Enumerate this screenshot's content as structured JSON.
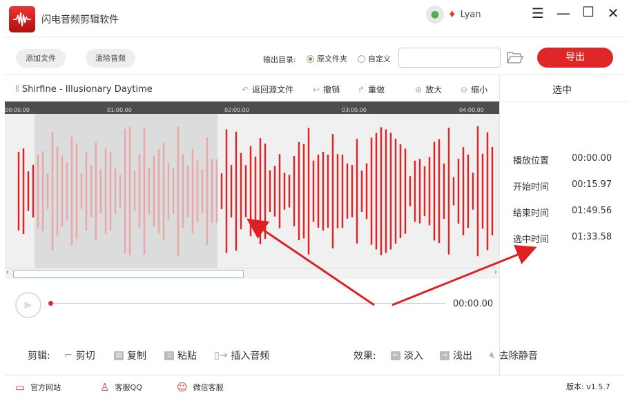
{
  "app": {
    "title": "闪电音频剪辑软件",
    "username": "Lyan"
  },
  "toolbar": {
    "add_file": "添加文件",
    "clear_audio": "清除音频",
    "output_label": "输出目录:",
    "opt_source": "原文件夹",
    "opt_custom": "自定义",
    "selected_option": "原文件夹",
    "path_value": "",
    "export": "导出"
  },
  "track": {
    "name": "Shirfine - Illusionary Daytime",
    "revert": "返回源文件",
    "undo": "撤销",
    "redo": "重做",
    "zoom_in": "放大",
    "zoom_out": "缩小",
    "timeline_ticks": [
      "00:00.00",
      "01:00.00",
      "02:00.00",
      "03:00.00",
      "04:00.00"
    ]
  },
  "side": {
    "title": "选中",
    "rows": [
      {
        "label": "播放位置",
        "value": "00:00.00"
      },
      {
        "label": "开始时间",
        "value": "00:15.97"
      },
      {
        "label": "结束时间",
        "value": "01:49.56"
      },
      {
        "label": "选中时间",
        "value": "01:33.58"
      }
    ]
  },
  "player": {
    "time": "00:00.00",
    "progress": 0
  },
  "edit": {
    "label": "剪辑:",
    "cut": "剪切",
    "copy": "复制",
    "paste": "粘贴",
    "insert": "插入音频",
    "effects_label": "效果:",
    "fade_in": "淡入",
    "fade_out": "浅出",
    "remove_silence": "去除静音"
  },
  "footer": {
    "website": "官方网站",
    "qq": "客服QQ",
    "wechat": "微信客服",
    "version": "版本: v1.5.7"
  },
  "colors": {
    "accent": "#e02727",
    "wave": "#d62828",
    "wave_selected": "#e8a8a8"
  }
}
